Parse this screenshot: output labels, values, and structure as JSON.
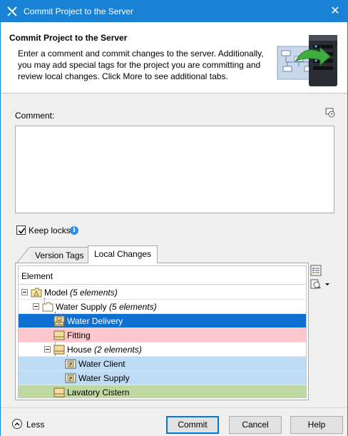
{
  "window": {
    "title": "Commit Project to the Server",
    "close_glyph": "✕",
    "colors": {
      "titlebar": "#1a82d4",
      "selection": "#0f70d1",
      "fitting_row": "#fcc8cd",
      "client_rows": "#bfdcf5",
      "cistern_row": "#bfd8a2"
    }
  },
  "header": {
    "title": "Commit Project to the Server",
    "description": "Enter a comment and commit changes to the server. Additionally, you may add special tags for the project you are committing and review local changes. Click More to see additional tabs.",
    "art_icon": "server-diagram-icon"
  },
  "comment": {
    "label": "Comment:",
    "value": "",
    "history_icon": "comment-history-icon"
  },
  "keep_locks": {
    "label": "Keep locks",
    "checked": true,
    "info_icon": "info-icon"
  },
  "tabs": [
    {
      "label": "Version Tags",
      "active": false
    },
    {
      "label": "Local Changes",
      "active": true
    }
  ],
  "tree": {
    "column_header": "Element",
    "rows": [
      {
        "name": "Model",
        "count": "(5 elements)",
        "icon": "model-package-icon",
        "expander": true,
        "state": "normal"
      },
      {
        "name": "Water Supply",
        "count": "(5 elements)",
        "icon": "folder-icon",
        "expander": true,
        "state": "normal"
      },
      {
        "name": "Water Delivery",
        "count": "",
        "icon": "diagram-icon",
        "expander": false,
        "state": "selected"
      },
      {
        "name": "Fitting",
        "count": "",
        "icon": "block-icon",
        "expander": false,
        "state": "deleted"
      },
      {
        "name": "House",
        "count": "(2 elements)",
        "icon": "block-icon",
        "expander": true,
        "state": "normal"
      },
      {
        "name": "Water Client",
        "count": "",
        "icon": "part-property-icon",
        "expander": false,
        "state": "modified"
      },
      {
        "name": "Water Supply",
        "count": "",
        "icon": "part-property-icon",
        "expander": false,
        "state": "modified"
      },
      {
        "name": "Lavatory Cistern",
        "count": "",
        "icon": "block-icon",
        "expander": false,
        "state": "added"
      }
    ]
  },
  "side_tools": [
    {
      "icon": "legend-list-icon"
    },
    {
      "icon": "find-dropdown-icon"
    }
  ],
  "footer": {
    "less_label": "Less",
    "commit_label": "Commit",
    "cancel_label": "Cancel",
    "help_label": "Help"
  }
}
